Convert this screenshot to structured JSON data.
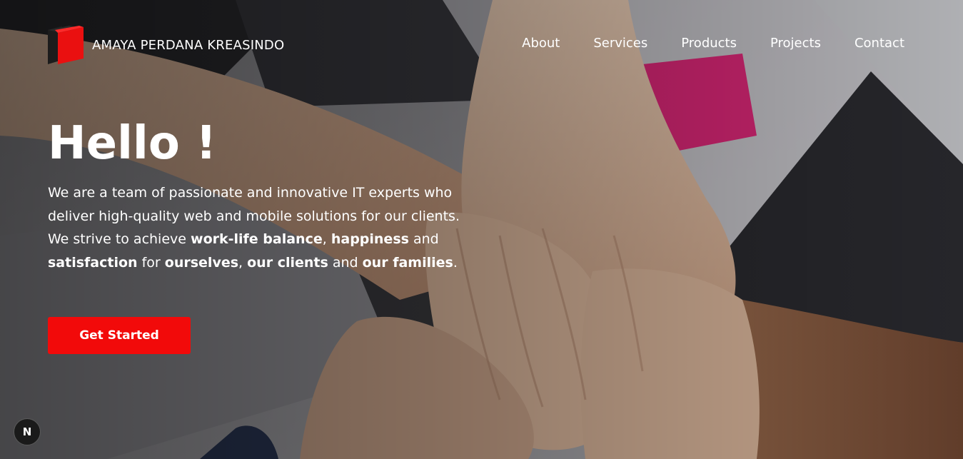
{
  "header": {
    "brand_name": "AMAYA PERDANA KREASINDO",
    "logo_icon": "red-box-logo",
    "nav": [
      {
        "label": "About"
      },
      {
        "label": "Services"
      },
      {
        "label": "Products"
      },
      {
        "label": "Projects"
      },
      {
        "label": "Contact"
      }
    ]
  },
  "hero": {
    "title": "Hello !",
    "text_parts": {
      "intro": "We are a team of passionate and innovative IT experts who deliver high-quality web and mobile solutions for our clients. We strive to achieve ",
      "strong1": "work-life balance",
      "sep1": ", ",
      "strong2": "happiness",
      "sep2": " and ",
      "strong3": "satisfaction",
      "sep3": " for ",
      "strong4": "ourselves",
      "sep4": ", ",
      "strong5": "our clients",
      "sep5": " and ",
      "strong6": "our families",
      "end": "."
    },
    "cta_label": "Get Started",
    "background": "stacked-hands-photo"
  },
  "dev_badge": {
    "label": "N",
    "icon": "nextjs-icon"
  },
  "colors": {
    "accent": "#f20a0a",
    "text": "#ffffff"
  }
}
